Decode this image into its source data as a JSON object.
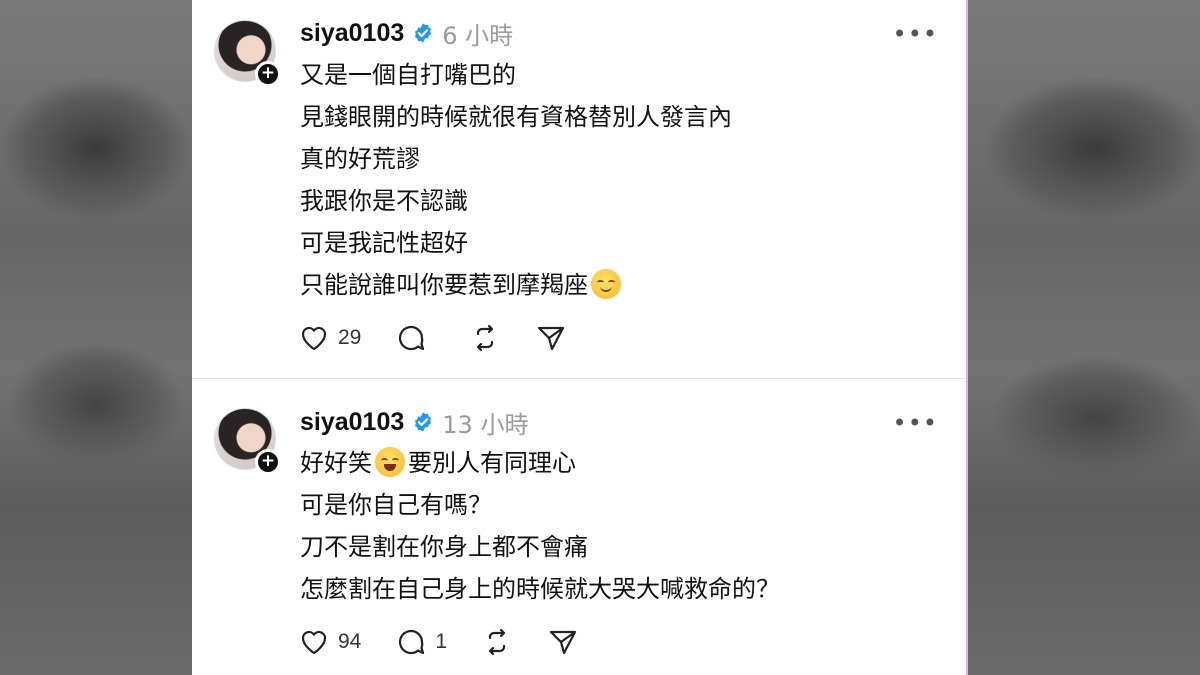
{
  "posts": [
    {
      "username": "siya0103",
      "time": "6 小時",
      "lines": [
        "又是一個自打嘴巴的",
        "見錢眼開的時候就很有資格替別人發言內",
        "真的好荒謬",
        "我跟你是不認識",
        "可是我記性超好",
        "只能說誰叫你要惹到摩羯座"
      ],
      "line_emoji": "relieved-face-emoji",
      "likes": "29",
      "replies": "",
      "more_label": "•••"
    },
    {
      "username": "siya0103",
      "time": "13 小時",
      "first_line_a": "好好笑",
      "first_line_b": "要別人有同理心",
      "lines": [
        "可是你自己有嗎？",
        "刀不是割在你身上都不會痛",
        "怎麼割在自己身上的時候就大哭大喊救命的？"
      ],
      "line_emoji": "grinning-squinting-face-emoji",
      "likes": "94",
      "replies": "1",
      "more_label": "•••"
    }
  ],
  "colors": {
    "verified": "#1d9bf0",
    "text": "#111111",
    "muted": "#9a9a9a"
  }
}
